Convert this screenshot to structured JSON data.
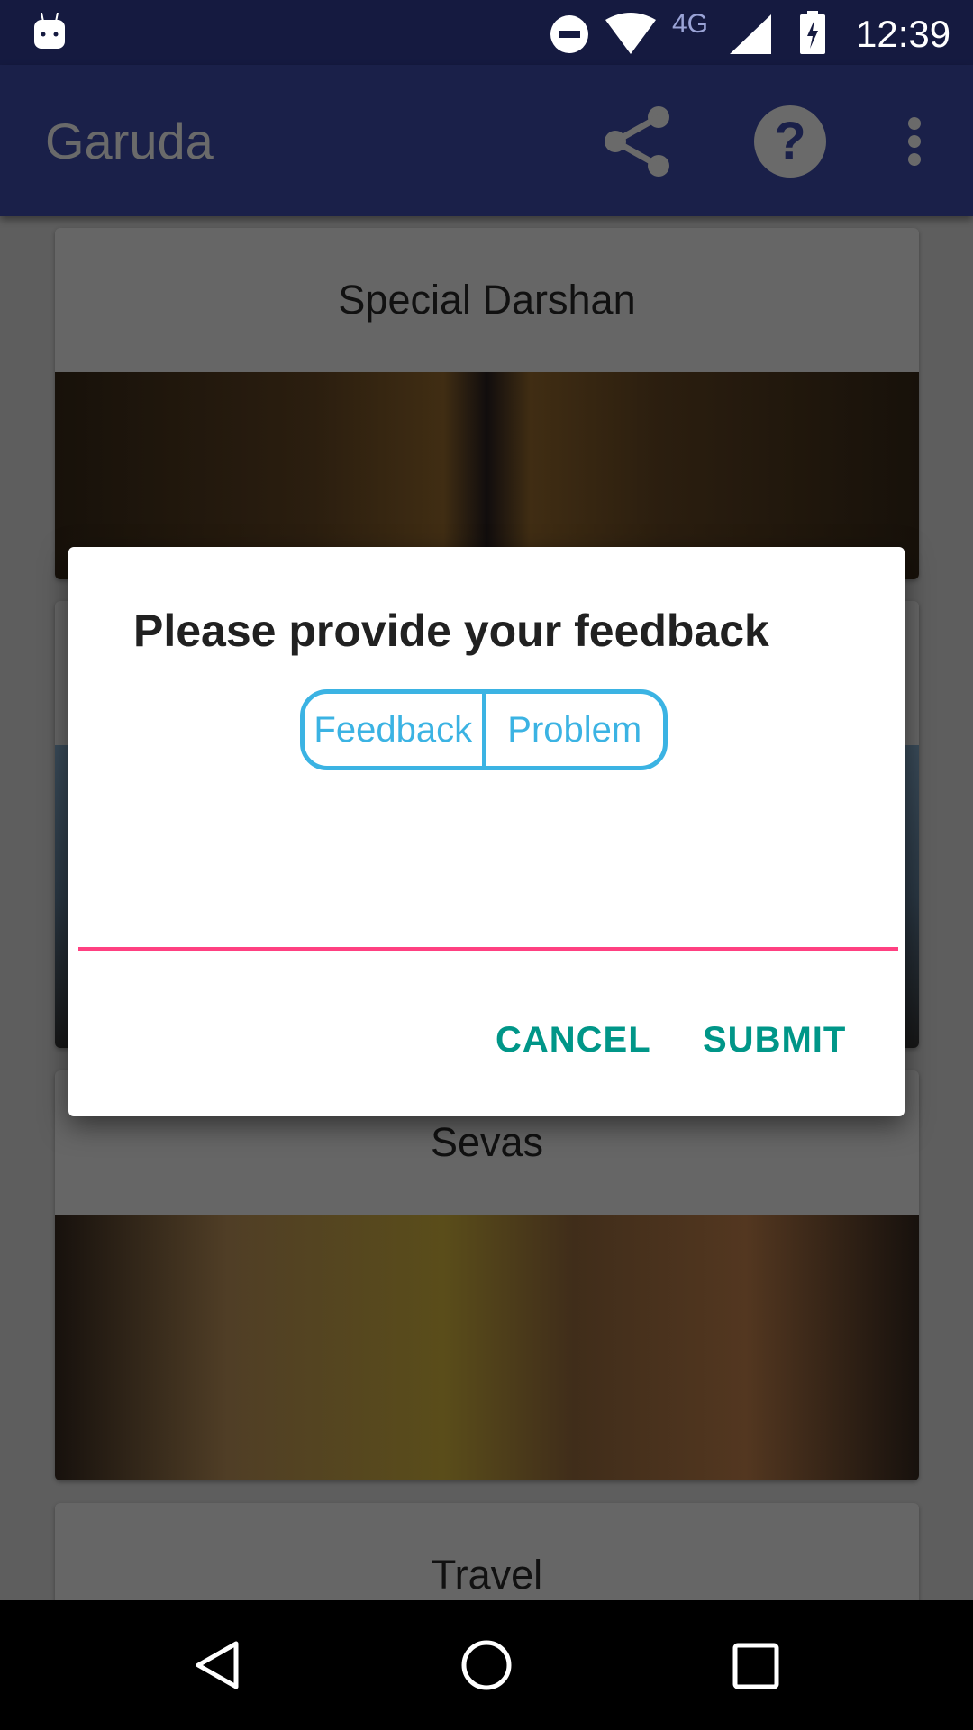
{
  "status_bar": {
    "time": "12:39",
    "network": "4G",
    "icons": [
      "android-notification-icon",
      "do-not-disturb-icon",
      "wifi-icon",
      "cell-signal-icon",
      "battery-charging-icon"
    ]
  },
  "app_bar": {
    "title": "Garuda",
    "actions": [
      "share-icon",
      "help-icon",
      "more-vert-icon"
    ]
  },
  "cards": [
    {
      "title": "Special Darshan"
    },
    {
      "title": ""
    },
    {
      "title": "Sevas"
    },
    {
      "title": "Travel"
    }
  ],
  "dialog": {
    "title": "Please provide your feedback",
    "segments": [
      "Feedback",
      "Problem"
    ],
    "input_value": "",
    "cancel_label": "CANCEL",
    "submit_label": "SUBMIT"
  },
  "colors": {
    "primary": "#3F51B5",
    "primary_dark": "#303F9F",
    "accent": "#FF4081",
    "segment": "#3BB3E3",
    "dialog_button": "#009688"
  },
  "nav_bar": {
    "buttons": [
      "back-icon",
      "home-icon",
      "recents-icon"
    ]
  }
}
